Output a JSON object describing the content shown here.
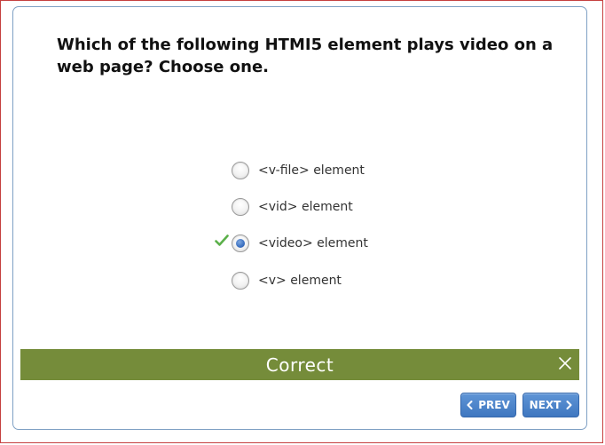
{
  "question": {
    "text": "Which of the following HTMI5 element plays video on a web page? Choose one."
  },
  "options": [
    {
      "label": "<v-file> element",
      "selected": false,
      "correct": false
    },
    {
      "label": "<vid> element",
      "selected": false,
      "correct": false
    },
    {
      "label": "<video> element",
      "selected": true,
      "correct": true
    },
    {
      "label": "<v> element",
      "selected": false,
      "correct": false
    }
  ],
  "feedback": {
    "text": "Correct",
    "color": "#758c3a"
  },
  "nav": {
    "prev_label": "PREV",
    "next_label": "NEXT",
    "button_color": "#4a82c9"
  },
  "icons": {
    "check": "check-icon",
    "close": "close-icon",
    "prev": "chevron-left-icon",
    "next": "chevron-right-icon"
  },
  "colors": {
    "frame_border": "#c5403f",
    "card_border": "#7fa0c4"
  }
}
